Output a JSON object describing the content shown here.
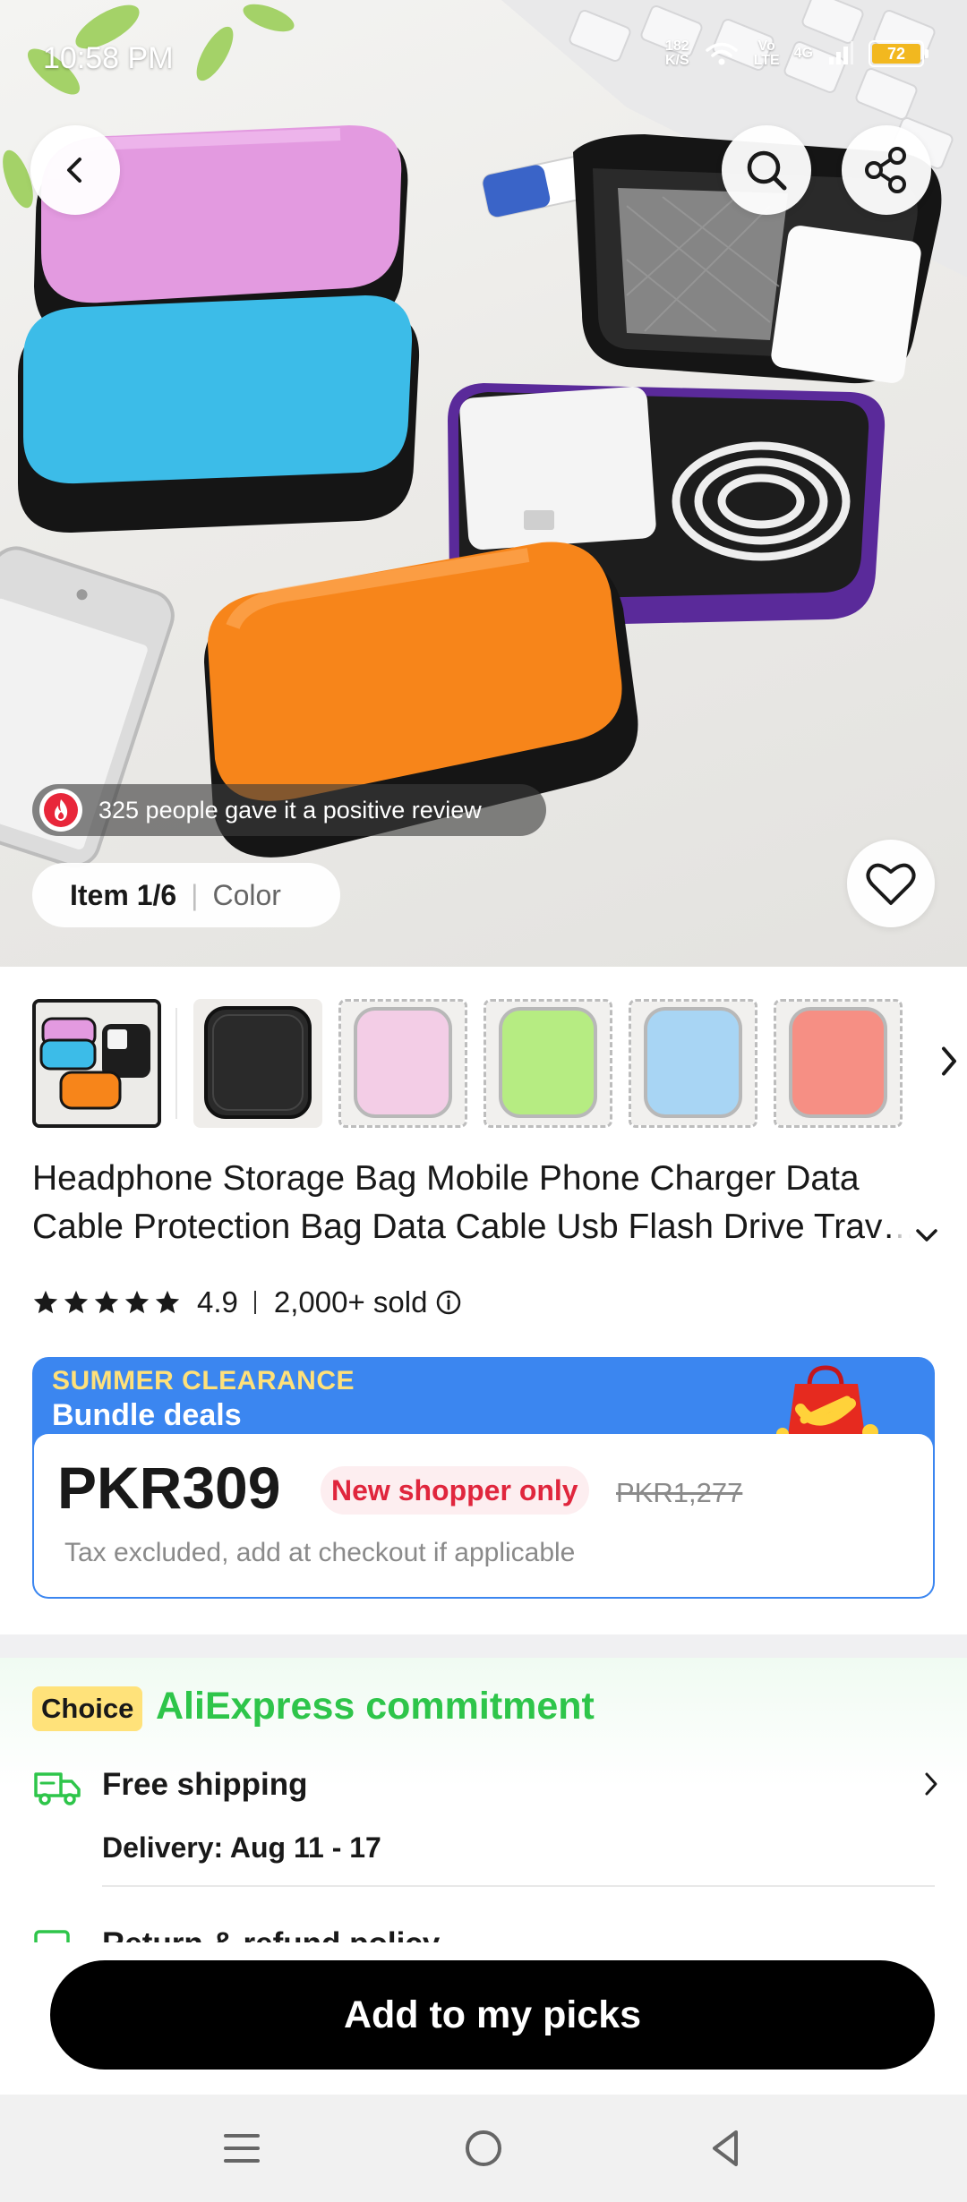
{
  "status_bar": {
    "time": "10:58 PM",
    "net_speed_value": "182",
    "net_speed_unit": "K/S",
    "volte_top": "Vo",
    "volte_bottom": "LTE",
    "network": "4G",
    "battery": "72"
  },
  "hero": {
    "review_text": "325 people gave it a positive review",
    "item_count": "Item 1/6",
    "item_variant": "Color"
  },
  "thumbnails": [
    {
      "color": "#8e8e8e",
      "selected": true
    },
    {
      "color": "#2a2a2a"
    },
    {
      "color": "#f3cde6"
    },
    {
      "color": "#b6ec82"
    },
    {
      "color": "#a8d5f4"
    },
    {
      "color": "#f68f84"
    }
  ],
  "product": {
    "title": "Headphone Storage Bag Mobile Phone Charger Data Cable Protection Bag Data Cable Usb Flash Drive Travel Storage Bag",
    "rating": "4.9",
    "sold": "2,000+ sold"
  },
  "deal": {
    "headline": "SUMMER CLEARANCE",
    "subheadline": "Bundle deals",
    "price": "PKR309",
    "tag": "New shopper only",
    "original_price": "PKR1,277",
    "tax_note": "Tax excluded, add at checkout if applicable"
  },
  "commitment": {
    "badge": "Choice",
    "title": "AliExpress commitment",
    "shipping_title": "Free shipping",
    "delivery": "Delivery: Aug 11 - 17",
    "next_item": "Return & refund policy"
  },
  "cta": {
    "label": "Add to my picks"
  },
  "colors": {
    "accent_green": "#2ec54a",
    "deal_blue": "#3b86f0",
    "price_red": "#e0263d",
    "choice_yellow": "#ffe27a"
  }
}
